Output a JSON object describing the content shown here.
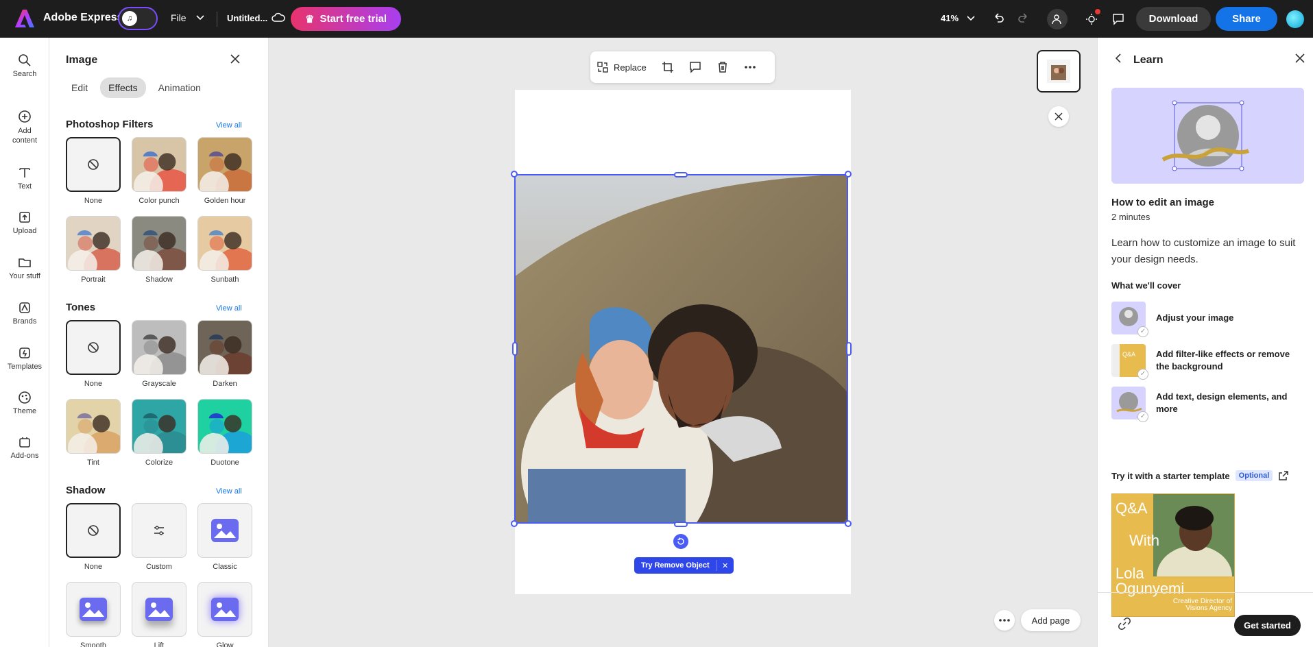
{
  "header": {
    "app_name": "Adobe Express",
    "file_label": "File",
    "doc_title": "Untitled...",
    "trial_label": "Start free trial",
    "zoom": "41%",
    "download_label": "Download",
    "share_label": "Share"
  },
  "rail": {
    "items": [
      {
        "label": "Search",
        "icon": "search-icon"
      },
      {
        "label": "Add content",
        "icon": "plus-circle-icon"
      },
      {
        "label": "Text",
        "icon": "text-icon"
      },
      {
        "label": "Upload",
        "icon": "upload-icon"
      },
      {
        "label": "Your stuff",
        "icon": "folder-icon"
      },
      {
        "label": "Brands",
        "icon": "brands-icon"
      },
      {
        "label": "Templates",
        "icon": "templates-icon"
      },
      {
        "label": "Theme",
        "icon": "palette-icon"
      },
      {
        "label": "Add-ons",
        "icon": "addons-icon"
      }
    ]
  },
  "panel": {
    "title": "Image",
    "tabs": [
      "Edit",
      "Effects",
      "Animation"
    ],
    "active_tab": "Effects",
    "view_all": "View all",
    "sections": [
      {
        "title": "Photoshop Filters",
        "items": [
          "None",
          "Color punch",
          "Golden hour",
          "Portrait",
          "Shadow",
          "Sunbath"
        ]
      },
      {
        "title": "Tones",
        "items": [
          "None",
          "Grayscale",
          "Darken",
          "Tint",
          "Colorize",
          "Duotone"
        ]
      },
      {
        "title": "Shadow",
        "items": [
          "None",
          "Custom",
          "Classic",
          "Smooth",
          "Lift",
          "Glow"
        ]
      }
    ]
  },
  "canvas": {
    "replace_label": "Replace",
    "remove_object_label": "Try Remove Object",
    "add_page_label": "Add page"
  },
  "learn": {
    "title": "Learn",
    "heading": "How to edit an image",
    "duration": "2 minutes",
    "description": "Learn how to customize an image to suit your design needs.",
    "cover_title": "What we'll cover",
    "steps": [
      "Adjust your image",
      "Add filter-like effects or remove the background",
      "Add text, design elements, and more"
    ],
    "try_label": "Try it with a starter template",
    "optional_label": "Optional",
    "template": {
      "line1": "Q&A",
      "line2": "With",
      "line3": "Lola Ogunyemi",
      "line4": "Creative Director of Visions Agency"
    },
    "get_started_label": "Get started"
  },
  "colors": {
    "accent": "#4a5cf5",
    "share_blue": "#1473e6",
    "hero_purple": "#d6d4ff",
    "template_yellow": "#e8bb4e"
  }
}
